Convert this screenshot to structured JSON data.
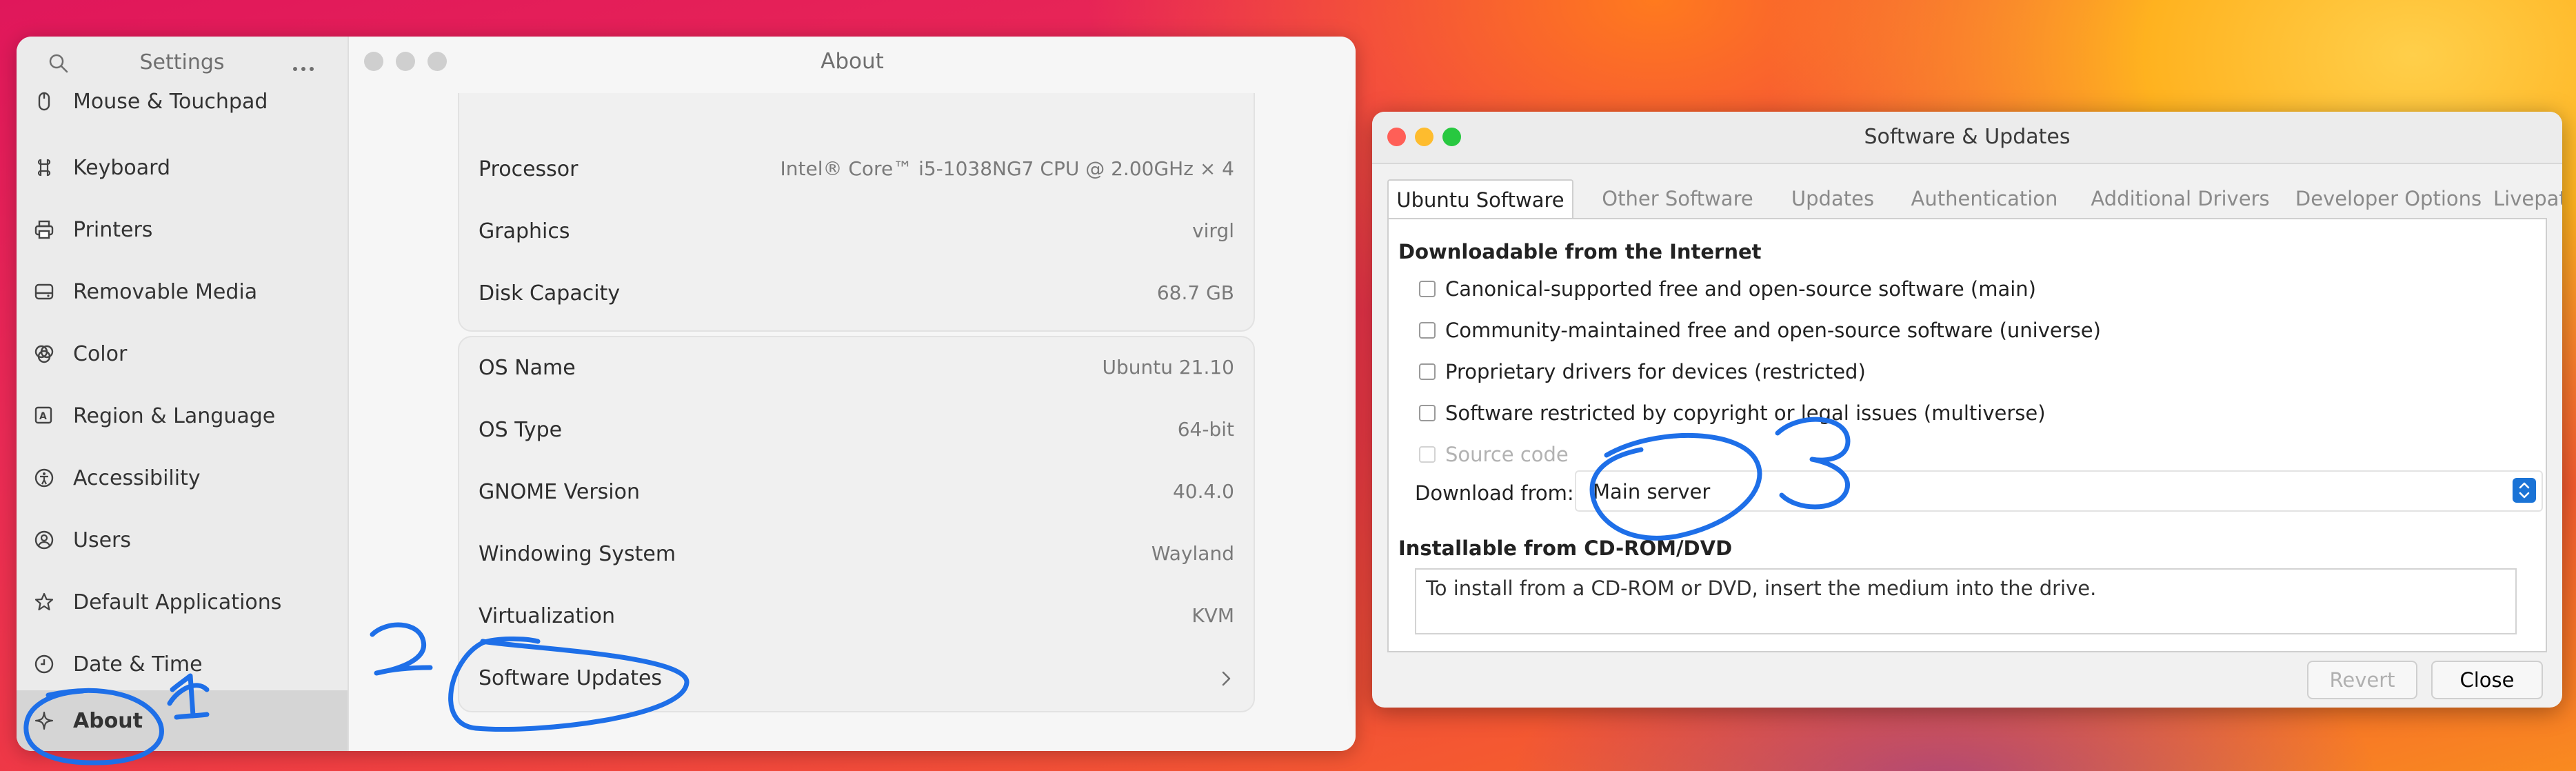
{
  "settings": {
    "sidebar": {
      "title": "Settings",
      "items": [
        {
          "label": "Mouse & Touchpad",
          "icon": "mouse-icon"
        },
        {
          "label": "Keyboard",
          "icon": "keyboard-icon"
        },
        {
          "label": "Printers",
          "icon": "printer-icon"
        },
        {
          "label": "Removable Media",
          "icon": "removable-media-icon"
        },
        {
          "label": "Color",
          "icon": "color-icon"
        },
        {
          "label": "Region & Language",
          "icon": "region-language-icon"
        },
        {
          "label": "Accessibility",
          "icon": "accessibility-icon"
        },
        {
          "label": "Users",
          "icon": "users-icon"
        },
        {
          "label": "Default Applications",
          "icon": "star-icon"
        },
        {
          "label": "Date & Time",
          "icon": "clock-icon"
        },
        {
          "label": "About",
          "icon": "sparkle-icon",
          "active": true
        }
      ]
    },
    "main": {
      "title": "About",
      "hardware": [
        {
          "key": "Processor",
          "value": "Intel® Core™ i5-1038NG7 CPU @ 2.00GHz × 4"
        },
        {
          "key": "Graphics",
          "value": "virgl"
        },
        {
          "key": "Disk Capacity",
          "value": "68.7 GB"
        }
      ],
      "system": [
        {
          "key": "OS Name",
          "value": "Ubuntu 21.10"
        },
        {
          "key": "OS Type",
          "value": "64-bit"
        },
        {
          "key": "GNOME Version",
          "value": "40.4.0"
        },
        {
          "key": "Windowing System",
          "value": "Wayland"
        },
        {
          "key": "Virtualization",
          "value": "KVM"
        }
      ],
      "software_updates_label": "Software Updates"
    }
  },
  "software_updates": {
    "title": "Software & Updates",
    "tabs": [
      "Ubuntu Software",
      "Other Software",
      "Updates",
      "Authentication",
      "Additional Drivers",
      "Developer Options",
      "Livepatch"
    ],
    "active_tab": "Ubuntu Software",
    "internet_section": "Downloadable from the Internet",
    "checkboxes": [
      {
        "label": "Canonical-supported free and open-source software (main)",
        "checked": false
      },
      {
        "label": "Community-maintained free and open-source software (universe)",
        "checked": false
      },
      {
        "label": "Proprietary drivers for devices (restricted)",
        "checked": false
      },
      {
        "label": "Software restricted by copyright or legal issues (multiverse)",
        "checked": false
      },
      {
        "label": "Source code",
        "checked": false,
        "disabled": true
      }
    ],
    "download_from_label": "Download from:",
    "download_from_value": "Main server",
    "cd_section": "Installable from CD-ROM/DVD",
    "cd_text": "To install from a CD-ROM or DVD, insert the medium into the drive.",
    "revert_label": "Revert",
    "close_label": "Close"
  },
  "annotations": [
    "1",
    "2",
    "3"
  ],
  "colors": {
    "annotation": "#1e6fe8",
    "accent": "#1a73d6",
    "close": "#ff5f57",
    "minimize": "#febc2e",
    "maximize": "#28c840"
  }
}
